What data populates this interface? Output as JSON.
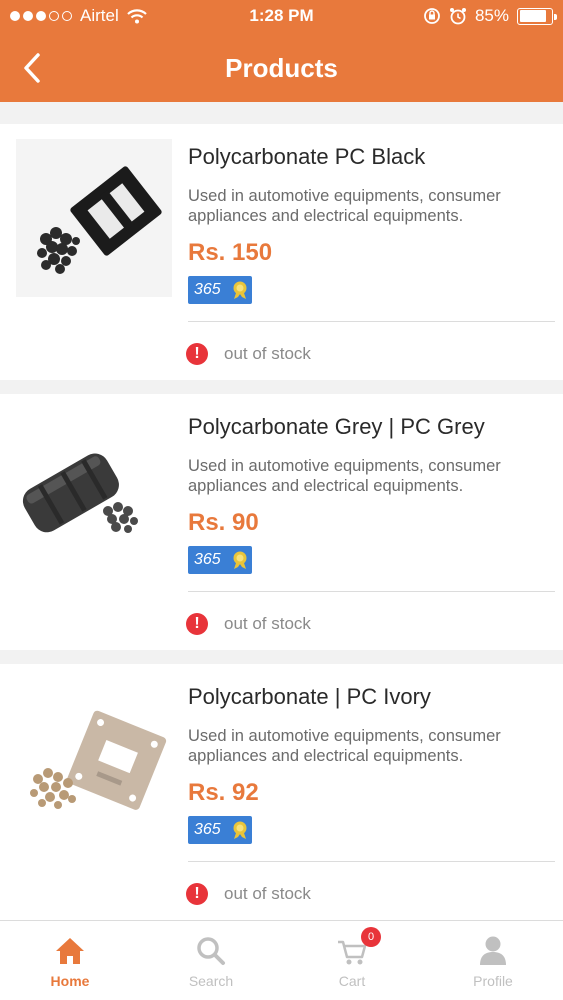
{
  "status_bar": {
    "carrier": "Airtel",
    "time": "1:28 PM",
    "battery": "85%",
    "battery_level": 0.85
  },
  "header": {
    "title": "Products"
  },
  "products": [
    {
      "name": "Polycarbonate PC Black",
      "description": "Used in automotive equipments, consumer appliances and electrical equipments.",
      "price": "Rs. 150",
      "badge": "365",
      "stock": "out of stock"
    },
    {
      "name": "Polycarbonate Grey | PC Grey",
      "description": "Used in automotive equipments, consumer appliances and electrical equipments.",
      "price": "Rs. 90",
      "badge": "365",
      "stock": "out of stock"
    },
    {
      "name": "Polycarbonate | PC Ivory",
      "description": "Used in automotive equipments, consumer appliances and electrical equipments.",
      "price": "Rs. 92",
      "badge": "365",
      "stock": "out of stock"
    }
  ],
  "tabbar": {
    "items": [
      {
        "label": "Home",
        "icon": "home-icon",
        "active": true
      },
      {
        "label": "Search",
        "icon": "search-icon",
        "active": false
      },
      {
        "label": "Cart",
        "icon": "cart-icon",
        "active": false,
        "badge": "0"
      },
      {
        "label": "Profile",
        "icon": "profile-icon",
        "active": false
      }
    ]
  },
  "colors": {
    "accent": "#e8793c",
    "badge_blue": "#3a7fd5",
    "alert_red": "#e8343a"
  }
}
